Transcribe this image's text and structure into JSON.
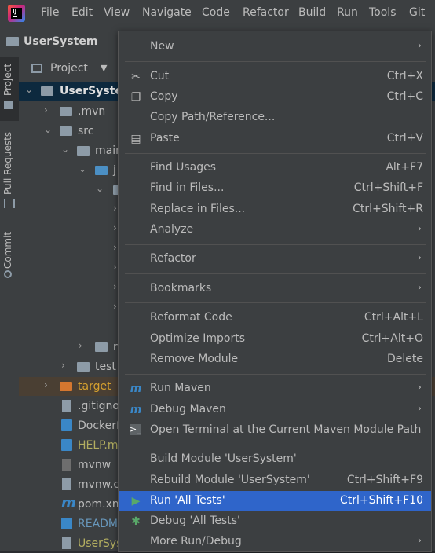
{
  "menubar": {
    "items": [
      "File",
      "Edit",
      "View",
      "Navigate",
      "Code",
      "Refactor",
      "Build",
      "Run",
      "Tools",
      "Git"
    ]
  },
  "project": {
    "name": "UserSystem"
  },
  "toolstrip": {
    "tabs": [
      "Project",
      "Pull Requests",
      "Commit"
    ]
  },
  "panel": {
    "title": "Project"
  },
  "tree": {
    "rows": [
      {
        "label": "UserSystem",
        "style": "bold"
      },
      {
        "label": ".mvn"
      },
      {
        "label": "src"
      },
      {
        "label": "main"
      },
      {
        "label": "j"
      },
      {
        "label": ""
      },
      {
        "label": ""
      },
      {
        "label": ""
      },
      {
        "label": ""
      },
      {
        "label": ""
      },
      {
        "label": ""
      },
      {
        "label": ""
      },
      {
        "label": "r"
      },
      {
        "label": "test"
      },
      {
        "label": "target"
      },
      {
        "label": ".gitigno"
      },
      {
        "label": "Dockerf"
      },
      {
        "label": "HELP.m"
      },
      {
        "label": "mvnw"
      },
      {
        "label": "mvnw.c"
      },
      {
        "label": "pom.xm"
      },
      {
        "label": "READM"
      },
      {
        "label": "UserSys"
      }
    ]
  },
  "context_menu": {
    "items": [
      {
        "label": "New",
        "shortcut": "",
        "submenu": true,
        "icon": ""
      },
      {
        "label": "Cut",
        "shortcut": "Ctrl+X",
        "submenu": false,
        "icon": "scissors-icon"
      },
      {
        "label": "Copy",
        "shortcut": "Ctrl+C",
        "submenu": false,
        "icon": "copy-icon"
      },
      {
        "label": "Copy Path/Reference...",
        "shortcut": "",
        "submenu": false,
        "icon": ""
      },
      {
        "label": "Paste",
        "shortcut": "Ctrl+V",
        "submenu": false,
        "icon": "paste-icon"
      },
      {
        "label": "Find Usages",
        "shortcut": "Alt+F7",
        "submenu": false,
        "icon": ""
      },
      {
        "label": "Find in Files...",
        "shortcut": "Ctrl+Shift+F",
        "submenu": false,
        "icon": ""
      },
      {
        "label": "Replace in Files...",
        "shortcut": "Ctrl+Shift+R",
        "submenu": false,
        "icon": ""
      },
      {
        "label": "Analyze",
        "shortcut": "",
        "submenu": true,
        "icon": ""
      },
      {
        "label": "Refactor",
        "shortcut": "",
        "submenu": true,
        "icon": ""
      },
      {
        "label": "Bookmarks",
        "shortcut": "",
        "submenu": true,
        "icon": ""
      },
      {
        "label": "Reformat Code",
        "shortcut": "Ctrl+Alt+L",
        "submenu": false,
        "icon": ""
      },
      {
        "label": "Optimize Imports",
        "shortcut": "Ctrl+Alt+O",
        "submenu": false,
        "icon": ""
      },
      {
        "label": "Remove Module",
        "shortcut": "Delete",
        "submenu": false,
        "icon": ""
      },
      {
        "label": "Run Maven",
        "shortcut": "",
        "submenu": true,
        "icon": "maven-run-icon"
      },
      {
        "label": "Debug Maven",
        "shortcut": "",
        "submenu": true,
        "icon": "maven-debug-icon"
      },
      {
        "label": "Open Terminal at the Current Maven Module Path",
        "shortcut": "",
        "submenu": false,
        "icon": "terminal-icon"
      },
      {
        "label": "Build Module 'UserSystem'",
        "shortcut": "",
        "submenu": false,
        "icon": ""
      },
      {
        "label": "Rebuild Module 'UserSystem'",
        "shortcut": "Ctrl+Shift+F9",
        "submenu": false,
        "icon": ""
      },
      {
        "label": "Run 'All Tests'",
        "shortcut": "Ctrl+Shift+F10",
        "submenu": false,
        "icon": "run-icon"
      },
      {
        "label": "Debug 'All Tests'",
        "shortcut": "",
        "submenu": false,
        "icon": "debug-icon"
      },
      {
        "label": "More Run/Debug",
        "shortcut": "",
        "submenu": true,
        "icon": ""
      }
    ]
  },
  "colors": {
    "accent": "#2f65ca",
    "maven_blue": "#3a87c7",
    "run_green": "#59a869",
    "excluded_orange": "#d5772f"
  }
}
